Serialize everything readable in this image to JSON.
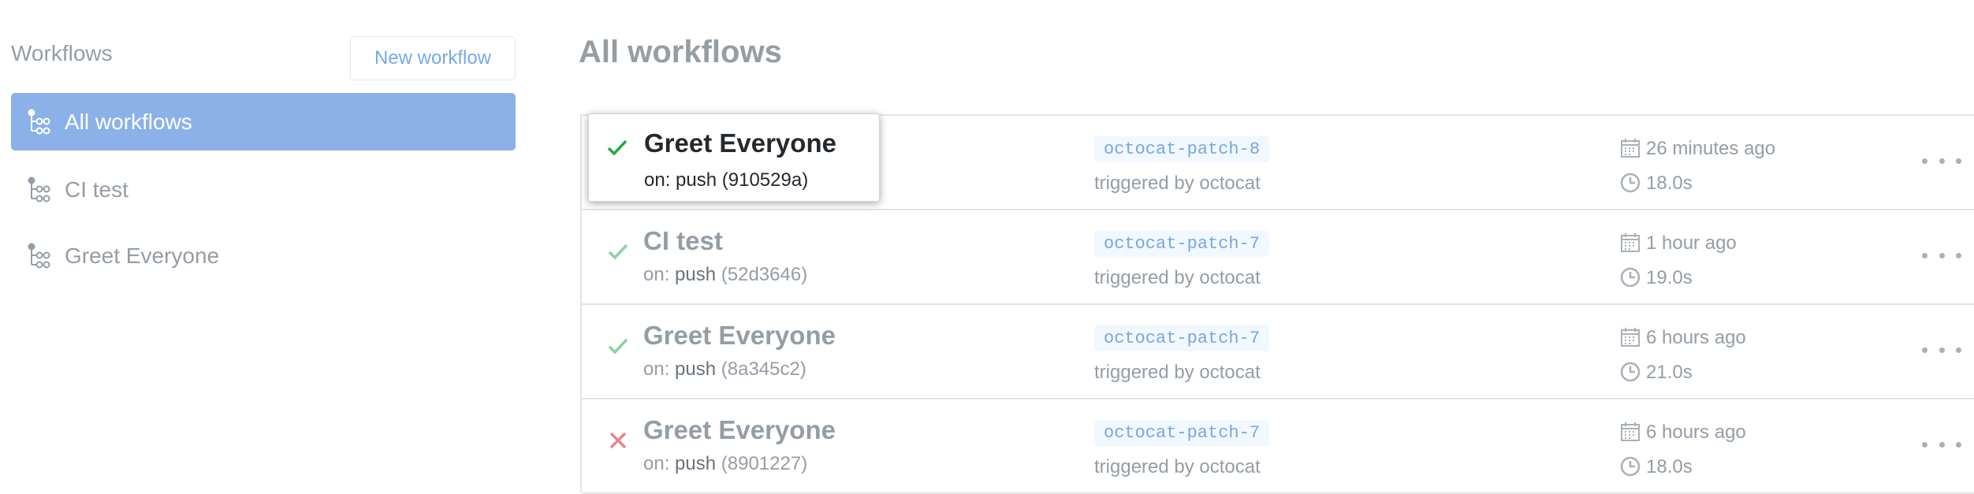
{
  "sidebar": {
    "title": "Workflows",
    "new_workflow_label": "New workflow",
    "items": [
      {
        "label": "All workflows",
        "icon": "workflow-icon",
        "active": true
      },
      {
        "label": "CI test",
        "icon": "workflow-icon",
        "active": false
      },
      {
        "label": "Greet Everyone",
        "icon": "workflow-icon",
        "active": false
      }
    ]
  },
  "main": {
    "title": "All workflows",
    "runs": [
      {
        "name": "Greet Everyone",
        "on_prefix": "on:",
        "event": "push",
        "commit": "(910529a)",
        "branch": "octocat-patch-8",
        "triggered": "triggered by octocat",
        "time_ago": "26 minutes ago",
        "duration": "18.0s",
        "status": "success"
      },
      {
        "name": "CI test",
        "on_prefix": "on:",
        "event": "push",
        "commit": "(52d3646)",
        "branch": "octocat-patch-7",
        "triggered": "triggered by octocat",
        "time_ago": "1 hour ago",
        "duration": "19.0s",
        "status": "success"
      },
      {
        "name": "Greet Everyone",
        "on_prefix": "on:",
        "event": "push",
        "commit": "(8a345c2)",
        "branch": "octocat-patch-7",
        "triggered": "triggered by octocat",
        "time_ago": "6 hours ago",
        "duration": "21.0s",
        "status": "success"
      },
      {
        "name": "Greet Everyone",
        "on_prefix": "on:",
        "event": "push",
        "commit": "(8901227)",
        "branch": "octocat-patch-7",
        "triggered": "triggered by octocat",
        "time_ago": "6 hours ago",
        "duration": "18.0s",
        "status": "failure"
      }
    ]
  },
  "colors": {
    "success": "#28a745",
    "success_muted": "#8fd19e",
    "failure_muted": "#e5868f",
    "active_item_bg": "#8cb1e8",
    "link": "#0366d6"
  }
}
